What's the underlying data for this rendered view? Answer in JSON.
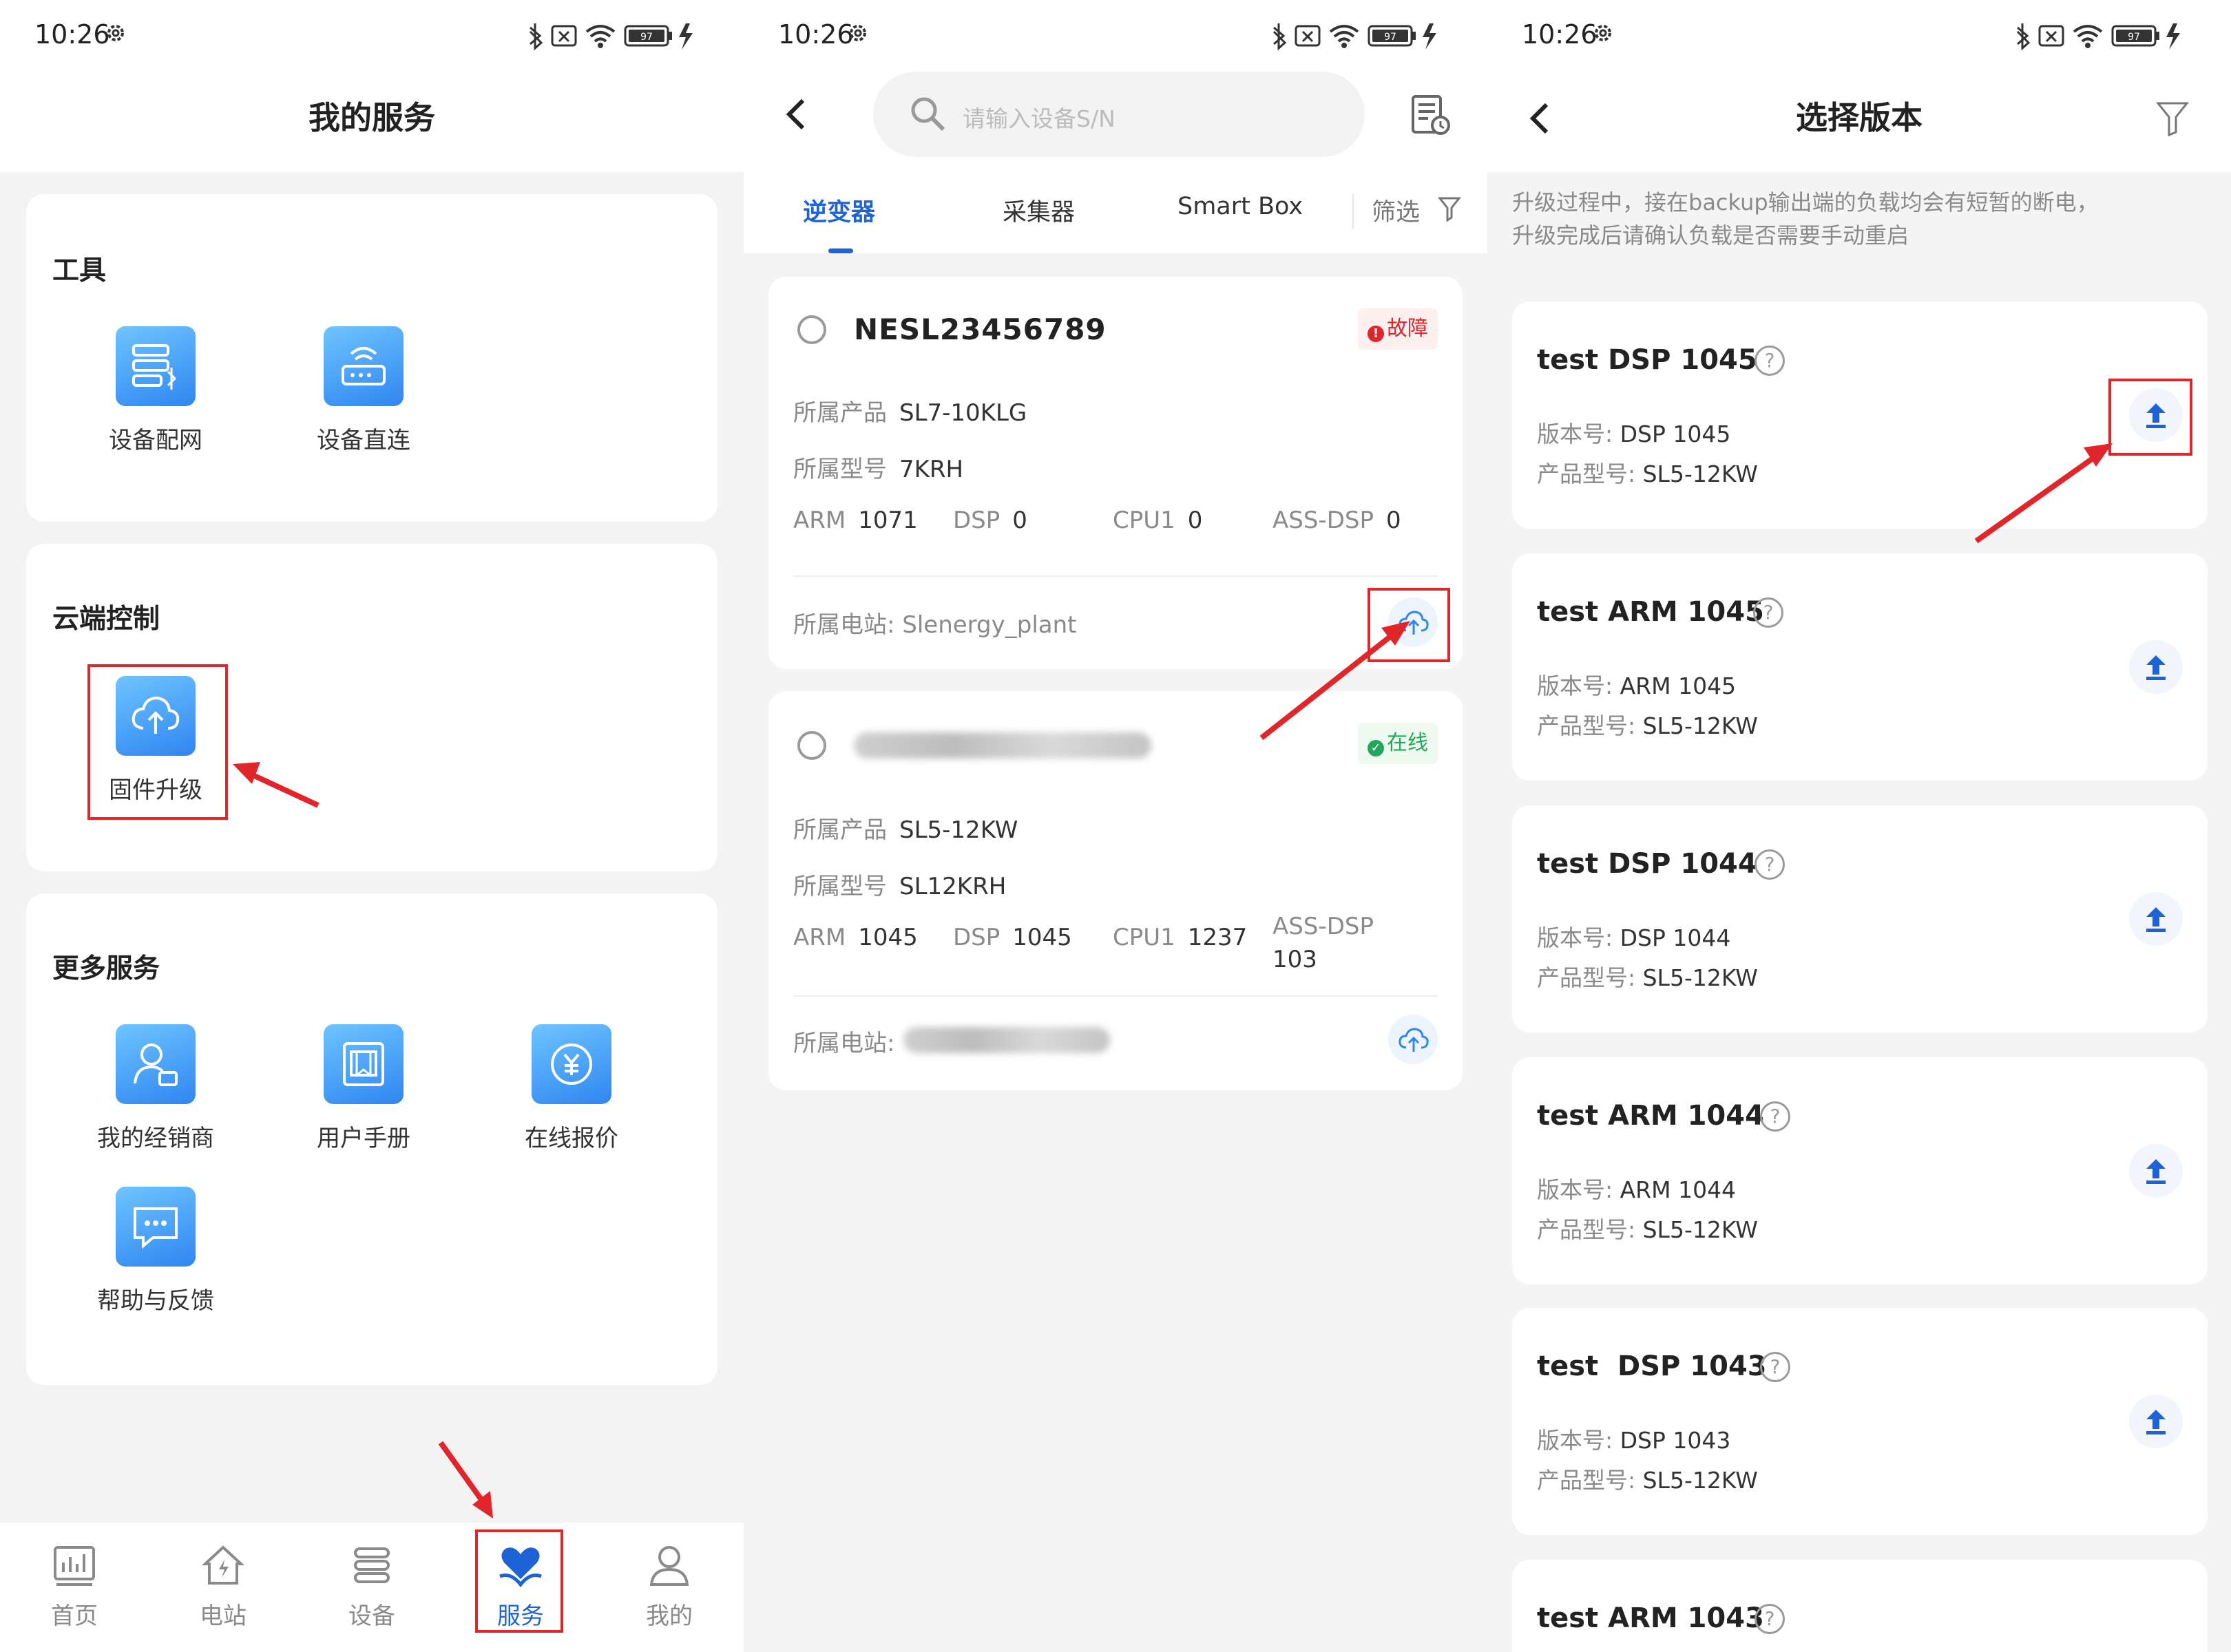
{
  "status": {
    "time": "10:26",
    "battery": "97"
  },
  "panel1": {
    "title": "我的服务",
    "sections": {
      "tools": {
        "title": "工具",
        "items": [
          "设备配网",
          "设备直连"
        ]
      },
      "cloud": {
        "title": "云端控制",
        "items": [
          "固件升级"
        ]
      },
      "more": {
        "title": "更多服务",
        "items": [
          "我的经销商",
          "用户手册",
          "在线报价",
          "帮助与反馈"
        ]
      }
    },
    "nav": [
      "首页",
      "电站",
      "设备",
      "服务",
      "我的"
    ]
  },
  "panel2": {
    "search_placeholder": "请输入设备S/N",
    "tabs": [
      "逆变器",
      "采集器",
      "Smart Box",
      "筛选"
    ],
    "devices": [
      {
        "sn": "NESL23456789",
        "status": "故障",
        "product_label": "所属产品",
        "product": "SL7-10KLG",
        "model_label": "所属型号",
        "model": "7KRH",
        "versions": [
          {
            "label": "ARM",
            "value": "1071"
          },
          {
            "label": "DSP",
            "value": "0"
          },
          {
            "label": "CPU1",
            "value": "0"
          },
          {
            "label": "ASS-DSP",
            "value": "0"
          }
        ],
        "plant": "所属电站: Slenergy_plant"
      },
      {
        "status": "在线",
        "product_label": "所属产品",
        "product": "SL5-12KW",
        "model_label": "所属型号",
        "model": "SL12KRH",
        "versions": [
          {
            "label": "ARM",
            "value": "1045"
          },
          {
            "label": "DSP",
            "value": "1045"
          },
          {
            "label": "CPU1",
            "value": "1237"
          },
          {
            "label": "ASS-DSP",
            "value": "103"
          }
        ],
        "plant": "所属电站:"
      }
    ]
  },
  "panel3": {
    "title": "选择版本",
    "notice_lines": [
      "升级过程中，接在backup输出端的负载均会有短暂的断电，",
      "升级完成后请确认负载是否需要手动重启"
    ],
    "version_label": "版本号: ",
    "model_label": "产品型号: ",
    "versions": [
      {
        "name": "test DSP 1045",
        "version": "DSP 1045",
        "model": "SL5-12KW"
      },
      {
        "name": "test ARM 1045",
        "version": "ARM 1045",
        "model": "SL5-12KW"
      },
      {
        "name": "test DSP 1044",
        "version": "DSP 1044",
        "model": "SL5-12KW"
      },
      {
        "name": "test ARM 1044",
        "version": "ARM 1044",
        "model": "SL5-12KW"
      },
      {
        "name": "test  DSP 1043",
        "version": "DSP 1043",
        "model": "SL5-12KW"
      },
      {
        "name": "test ARM 1043"
      }
    ]
  },
  "colors": {
    "accent": "#1e63d6",
    "highlight_box": "#e0262a",
    "arrow": "#e0262a",
    "fault": "#e0262a",
    "online": "#22a85a"
  }
}
